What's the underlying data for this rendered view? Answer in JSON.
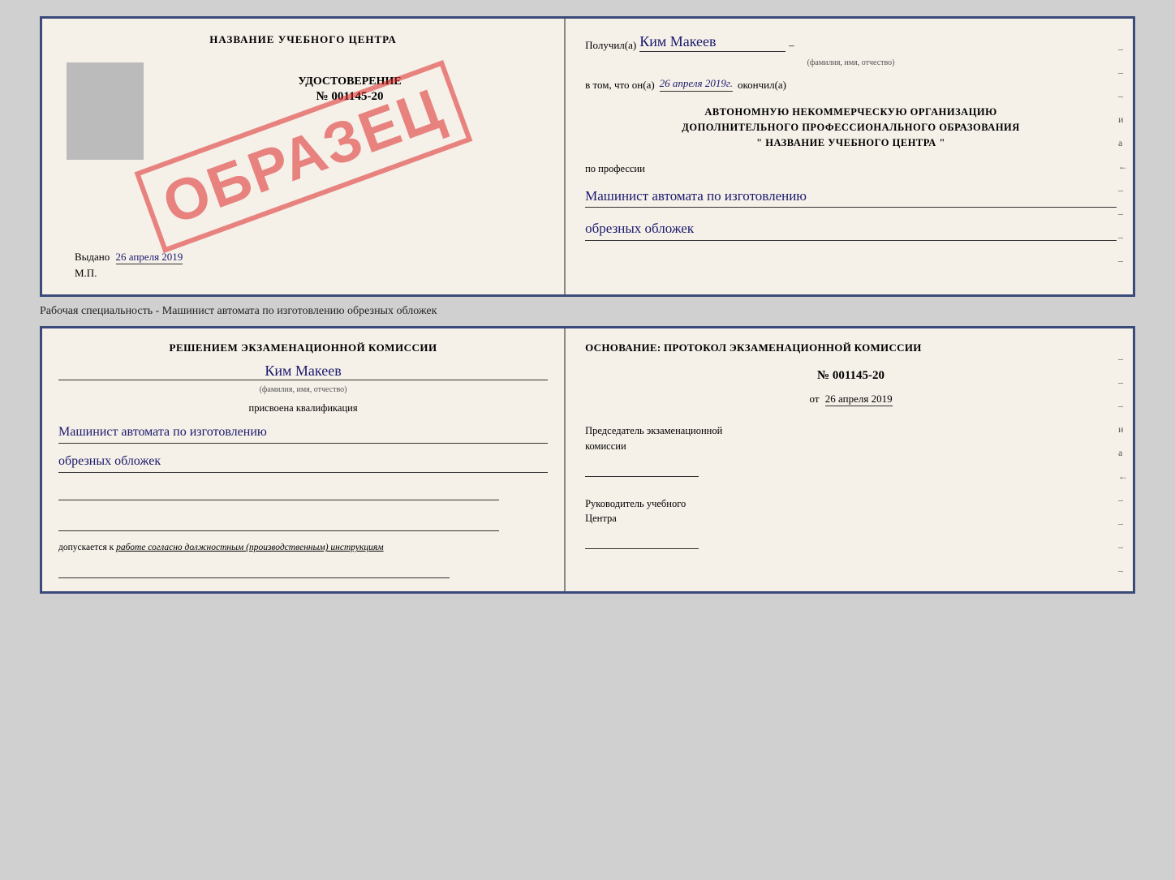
{
  "cert": {
    "left": {
      "title": "НАЗВАНИЕ УЧЕБНОГО ЦЕНТРА",
      "stamp": "ОБРАЗЕЦ",
      "udost_title": "УДОСТОВЕРЕНИЕ",
      "number": "№ 001145-20",
      "vydano_label": "Выдано",
      "vydano_date": "26 апреля 2019",
      "mp_label": "М.П."
    },
    "right": {
      "poluchil_label": "Получил(а)",
      "poluchil_name": "Ким Макеев",
      "fio_hint": "(фамилия, имя, отчество)",
      "dash1": "–",
      "vtom_label": "в том, что он(а)",
      "vtom_date": "26 апреля 2019г.",
      "okonchil_label": "окончил(а)",
      "org_line1": "АВТОНОМНУЮ НЕКОММЕРЧЕСКУЮ ОРГАНИЗАЦИЮ",
      "org_line2": "ДОПОЛНИТЕЛЬНОГО ПРОФЕССИОНАЛЬНОГО ОБРАЗОВАНИЯ",
      "org_name": "\" НАЗВАНИЕ УЧЕБНОГО ЦЕНТРА \"",
      "profession_label": "по профессии",
      "profession_value_1": "Машинист автомата по изготовлению",
      "profession_value_2": "обрезных обложек",
      "dashes": [
        "–",
        "–",
        "–",
        "и",
        "а",
        "←",
        "–",
        "–",
        "–",
        "–"
      ]
    }
  },
  "specialty_label": "Рабочая специальность - Машинист автомата по изготовлению обрезных обложек",
  "qual": {
    "left": {
      "komissia_text": "Решением экзаменационной комиссии",
      "komissia_name": "Ким Макеев",
      "fio_hint": "(фамилия, имя, отчество)",
      "prisvoena_text": "присвоена квалификация",
      "profession_1": "Машинист автомата по изготовлению",
      "profession_2": "обрезных обложек",
      "dopuskaetsya_label": "допускается к",
      "dopuskaetsya_value": "работе согласно должностным (производственным) инструкциям"
    },
    "right": {
      "osnovanie_text": "Основание: протокол экзаменационной комиссии",
      "protocol_number": "№ 001145-20",
      "ot_label": "от",
      "ot_date": "26 апреля 2019",
      "chairman_line1": "Председатель экзаменационной",
      "chairman_line2": "комиссии",
      "rukovat_line1": "Руководитель учебного",
      "rukovat_line2": "Центра",
      "dashes": [
        "–",
        "–",
        "–",
        "и",
        "а",
        "←",
        "–",
        "–",
        "–",
        "–"
      ]
    }
  }
}
